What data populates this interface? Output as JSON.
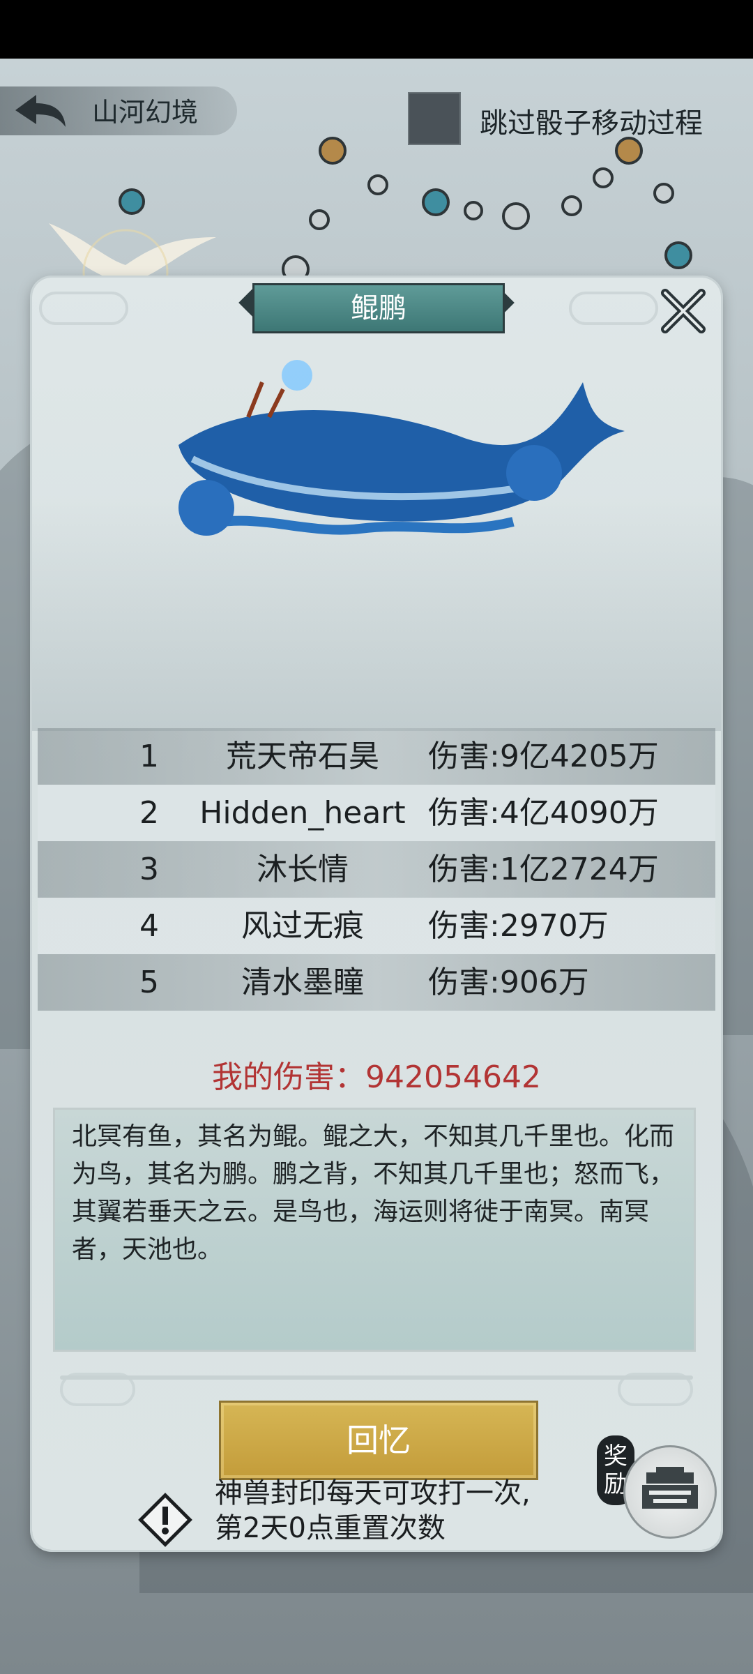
{
  "topbar": {
    "scene_title": "山河幻境",
    "skip_label": "跳过骰子移动过程"
  },
  "panel": {
    "title": "鲲鹏",
    "ranking": [
      {
        "rank": "1",
        "name": "荒天帝石昊",
        "damage": "伤害:9亿4205万"
      },
      {
        "rank": "2",
        "name": "Hidden_heart",
        "damage": "伤害:4亿4090万"
      },
      {
        "rank": "3",
        "name": "沐长情",
        "damage": "伤害:1亿2724万"
      },
      {
        "rank": "4",
        "name": "风过无痕",
        "damage": "伤害:2970万"
      },
      {
        "rank": "5",
        "name": "清水墨瞳",
        "damage": "伤害:906万"
      }
    ],
    "my_damage_label": "我的伤害：",
    "my_damage_value": "942054642",
    "lore": "北冥有鱼，其名为鲲。鲲之大，不知其几千里也。化而为鸟，其名为鹏。鹏之背，不知其几千里也；怒而飞，其翼若垂天之云。是鸟也，海运则将徙于南冥。南冥者，天池也。",
    "recall_button": "回忆",
    "notice_line1": "神兽封印每天可攻打一次,",
    "notice_line2": "第2天0点重置次数",
    "reward_label": "奖励"
  },
  "colors": {
    "title_banner": "#4f8a87",
    "my_damage": "#b23434",
    "recall_button": "#c9a545"
  },
  "icons": [
    "back-arrow-icon",
    "close-icon",
    "warning-icon",
    "reward-chest-icon"
  ]
}
